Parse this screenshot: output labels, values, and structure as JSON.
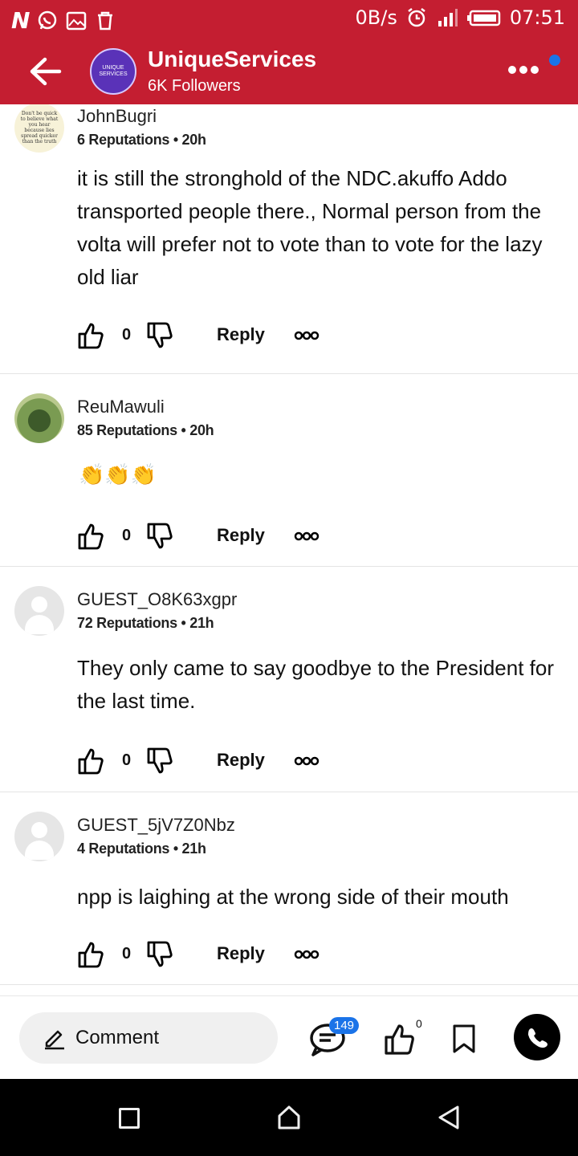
{
  "status": {
    "net_speed": "0B/s",
    "time": "07:51"
  },
  "header": {
    "avatar_text": "UNIQUE SERVICES",
    "channel_name": "UniqueServices",
    "followers": "6K Followers"
  },
  "comments": [
    {
      "name": "JohnBugri",
      "meta": "6 Reputations • 20h",
      "avatar_text": "Don't be quick to believe what you hear because lies spread quicker than the truth",
      "text": "it is still the stronghold of the NDC.akuffo Addo transported people there., Normal person from the volta will prefer not to vote than to vote for the lazy old liar",
      "likes": "0",
      "reply": "Reply"
    },
    {
      "name": "ReuMawuli",
      "meta": "85 Reputations • 20h",
      "emoji": "👏👏👏",
      "likes": "0",
      "reply": "Reply"
    },
    {
      "name": "GUEST_O8K63xgpr",
      "meta": "72 Reputations • 21h",
      "text": "They only came to say goodbye to the President for the last time.",
      "likes": "0",
      "reply": "Reply"
    },
    {
      "name": "GUEST_5jV7Z0Nbz",
      "meta": "4 Reputations • 21h",
      "text": "npp is laighing at the wrong side of their mouth",
      "likes": "0",
      "reply": "Reply"
    }
  ],
  "bottom": {
    "comment_label": "Comment",
    "comment_count": "149",
    "like_count": "0"
  },
  "colors": {
    "brand_red": "#c41e31",
    "badge_blue": "#1a73e8"
  }
}
